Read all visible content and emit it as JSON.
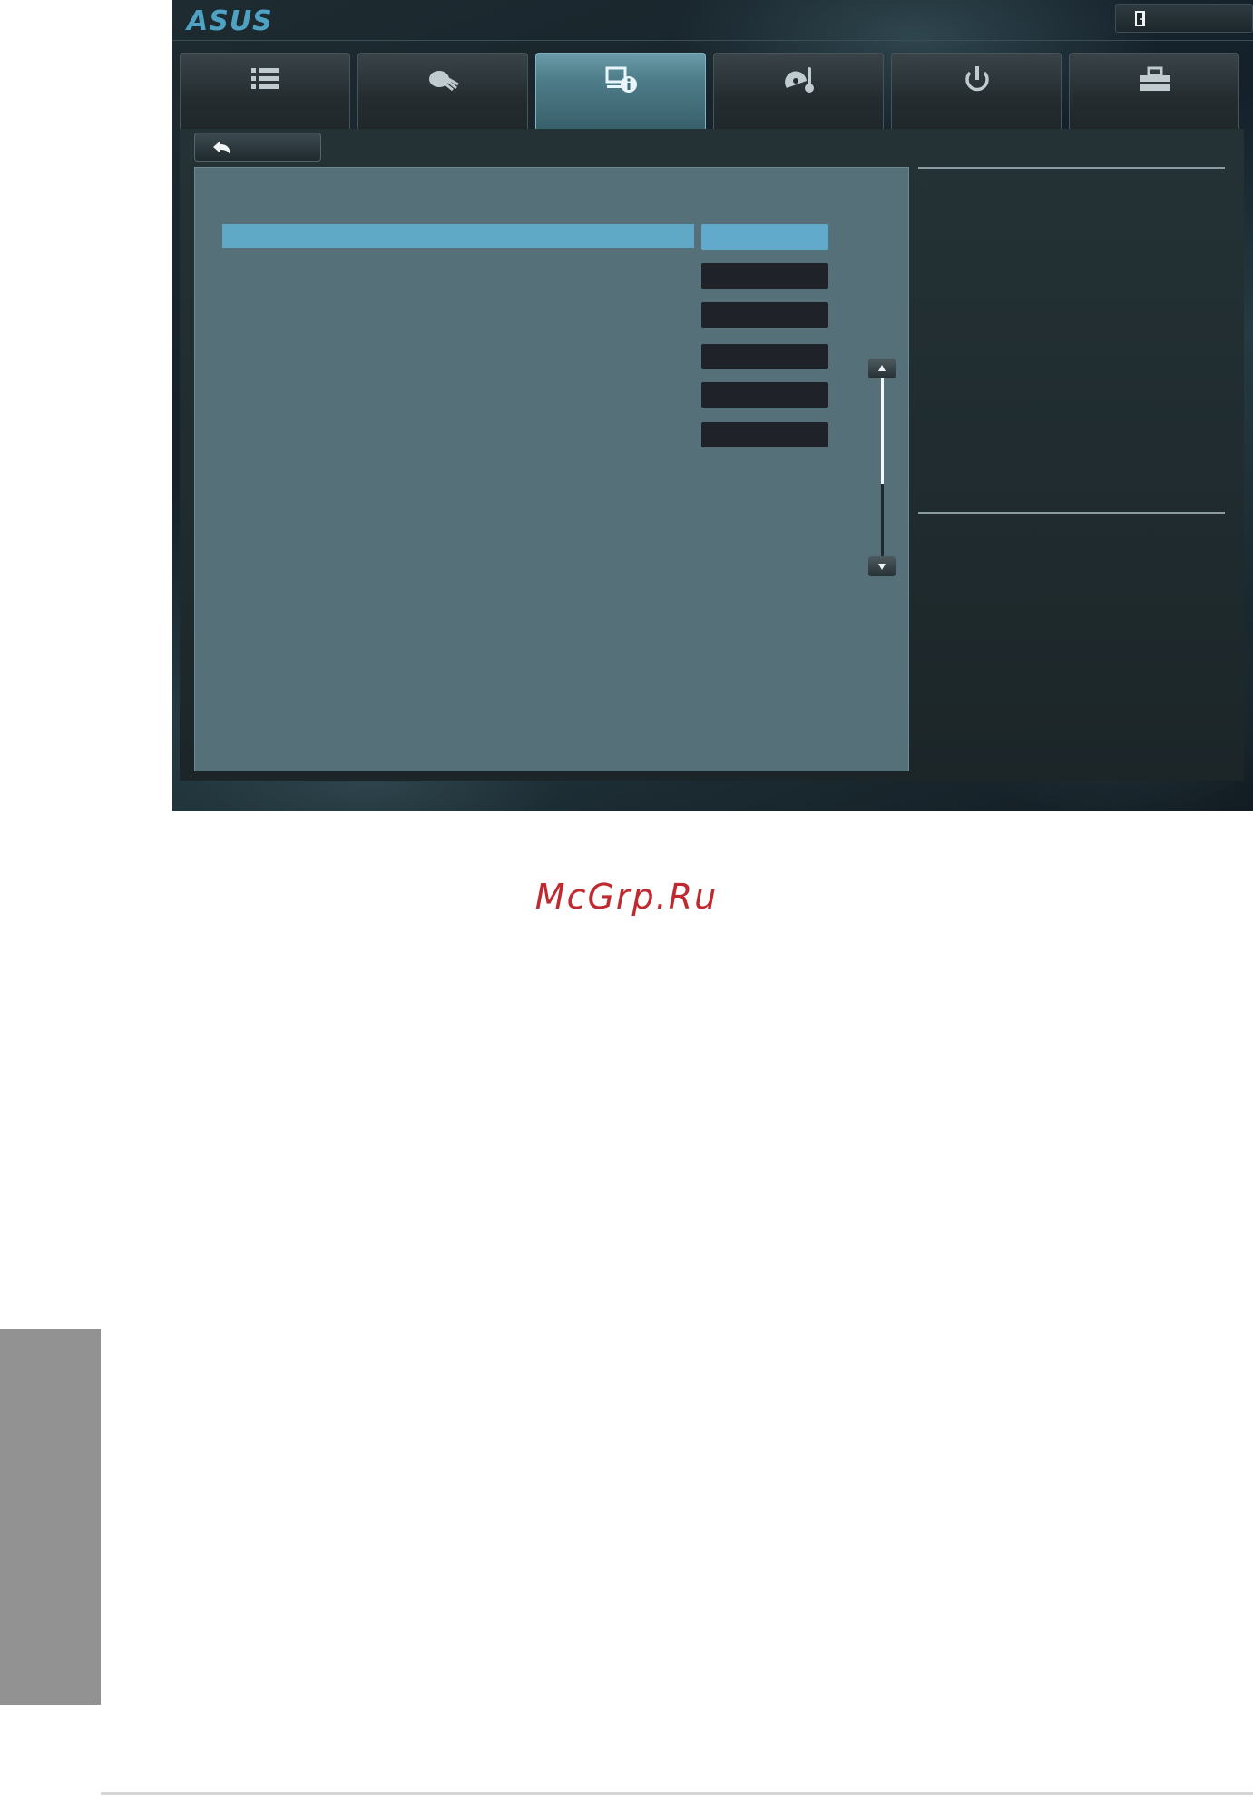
{
  "brand": {
    "logo_text": "ASUS",
    "accent_color": "#5aa3c2"
  },
  "header": {
    "exit_label": "",
    "exit_icon": "door-exit-icon"
  },
  "tabs": [
    {
      "label": "",
      "icon": "main-list-icon",
      "active": false
    },
    {
      "label": "",
      "icon": "ai-tweaker-icon",
      "active": false
    },
    {
      "label": "",
      "icon": "advanced-info-icon",
      "active": true
    },
    {
      "label": "",
      "icon": "monitor-thermometer-icon",
      "active": false
    },
    {
      "label": "",
      "icon": "power-icon",
      "active": false
    },
    {
      "label": "",
      "icon": "tool-icon",
      "active": false
    }
  ],
  "back_button": {
    "label": "",
    "icon": "back-arrow-icon"
  },
  "settings": {
    "rows": [
      {
        "label": "",
        "value": "",
        "selected": true
      },
      {
        "label": "",
        "value": "",
        "selected": false
      },
      {
        "label": "",
        "value": "",
        "selected": false
      },
      {
        "label": "",
        "value": "",
        "selected": false
      },
      {
        "label": "",
        "value": "",
        "selected": false
      },
      {
        "label": "",
        "value": "",
        "selected": false
      }
    ],
    "colors": {
      "selected_row": "#5fa9c6",
      "value_box": "#1f2329",
      "panel": "#557078"
    }
  },
  "help": {
    "text": "",
    "footer_text": ""
  },
  "watermark": {
    "text": "McGrp.Ru",
    "color": "#c0292f"
  }
}
